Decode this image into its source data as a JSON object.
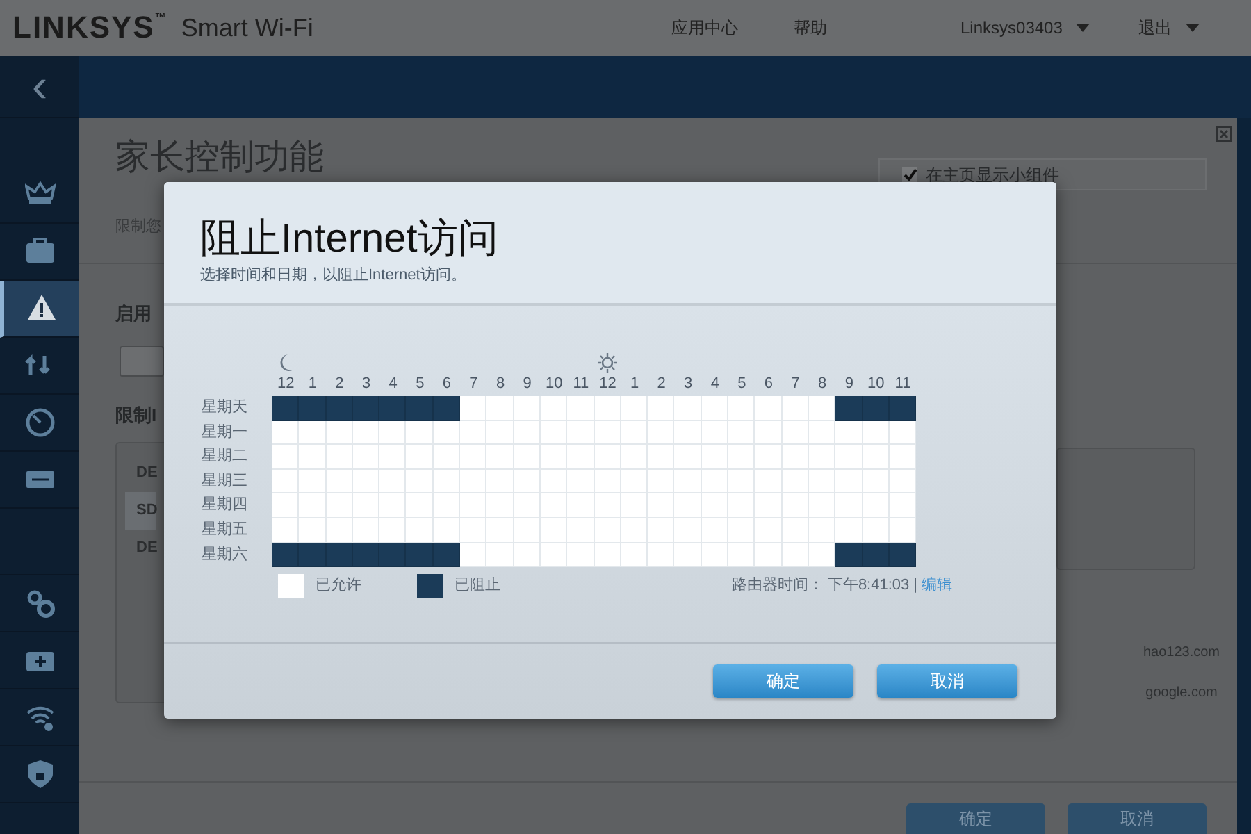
{
  "header": {
    "logo": "LINKSYS",
    "logo_mark": "™",
    "product": "Smart Wi-Fi",
    "nav": [
      {
        "label": "应用中心",
        "dropdown": false
      },
      {
        "label": "帮助",
        "dropdown": false
      },
      {
        "label": "Linksys03403",
        "dropdown": true
      },
      {
        "label": "退出",
        "dropdown": true
      }
    ]
  },
  "sidebar": {
    "back": "‹",
    "items": [
      {
        "selected": false
      },
      {
        "selected": false
      },
      {
        "selected": true
      },
      {
        "selected": false
      },
      {
        "selected": false
      },
      {
        "selected": false
      },
      {
        "selected": false
      },
      {
        "selected": false
      },
      {
        "selected": false
      },
      {
        "selected": false
      }
    ]
  },
  "page": {
    "title": "家长控制功能",
    "subtitle": "限制您",
    "widget_checkbox": {
      "label": "在主页显示小组件",
      "checked": true
    },
    "enable_label": "启用",
    "enable_toggle": {
      "on": false
    },
    "restrict_label": "限制I",
    "devices": [
      {
        "name": "DE",
        "selected": false
      },
      {
        "name": "SD",
        "selected": true
      },
      {
        "name": "DE",
        "selected": false
      }
    ],
    "sites": [
      "hao123.com",
      "google.com"
    ],
    "buttons": [
      "确定",
      "取消"
    ]
  },
  "dialog": {
    "title": "阻止Internet访问",
    "subtitle": "选择时间和日期，以阻止Internet访问。",
    "hours": [
      "12",
      "1",
      "2",
      "3",
      "4",
      "5",
      "6",
      "7",
      "8",
      "9",
      "10",
      "11",
      "12",
      "1",
      "2",
      "3",
      "4",
      "5",
      "6",
      "7",
      "8",
      "9",
      "10",
      "11"
    ],
    "days": [
      {
        "label": "星期天",
        "blocked": [
          true,
          true,
          true,
          true,
          true,
          true,
          true,
          false,
          false,
          false,
          false,
          false,
          false,
          false,
          false,
          false,
          false,
          false,
          false,
          false,
          false,
          true,
          true,
          true
        ]
      },
      {
        "label": "星期一",
        "blocked": [
          false,
          false,
          false,
          false,
          false,
          false,
          false,
          false,
          false,
          false,
          false,
          false,
          false,
          false,
          false,
          false,
          false,
          false,
          false,
          false,
          false,
          false,
          false,
          false
        ]
      },
      {
        "label": "星期二",
        "blocked": [
          false,
          false,
          false,
          false,
          false,
          false,
          false,
          false,
          false,
          false,
          false,
          false,
          false,
          false,
          false,
          false,
          false,
          false,
          false,
          false,
          false,
          false,
          false,
          false
        ]
      },
      {
        "label": "星期三",
        "blocked": [
          false,
          false,
          false,
          false,
          false,
          false,
          false,
          false,
          false,
          false,
          false,
          false,
          false,
          false,
          false,
          false,
          false,
          false,
          false,
          false,
          false,
          false,
          false,
          false
        ]
      },
      {
        "label": "星期四",
        "blocked": [
          false,
          false,
          false,
          false,
          false,
          false,
          false,
          false,
          false,
          false,
          false,
          false,
          false,
          false,
          false,
          false,
          false,
          false,
          false,
          false,
          false,
          false,
          false,
          false
        ]
      },
      {
        "label": "星期五",
        "blocked": [
          false,
          false,
          false,
          false,
          false,
          false,
          false,
          false,
          false,
          false,
          false,
          false,
          false,
          false,
          false,
          false,
          false,
          false,
          false,
          false,
          false,
          false,
          false,
          false
        ]
      },
      {
        "label": "星期六",
        "blocked": [
          true,
          true,
          true,
          true,
          true,
          true,
          true,
          false,
          false,
          false,
          false,
          false,
          false,
          false,
          false,
          false,
          false,
          false,
          false,
          false,
          false,
          true,
          true,
          true
        ]
      }
    ],
    "legend": [
      {
        "label": "已允许",
        "blocked": false
      },
      {
        "label": "已阻止",
        "blocked": true
      }
    ],
    "router_time_label": "路由器时间：",
    "router_time": "下午8:41:03",
    "separator": "|",
    "edit_link": "编辑",
    "buttons": [
      "确定",
      "取消"
    ]
  }
}
